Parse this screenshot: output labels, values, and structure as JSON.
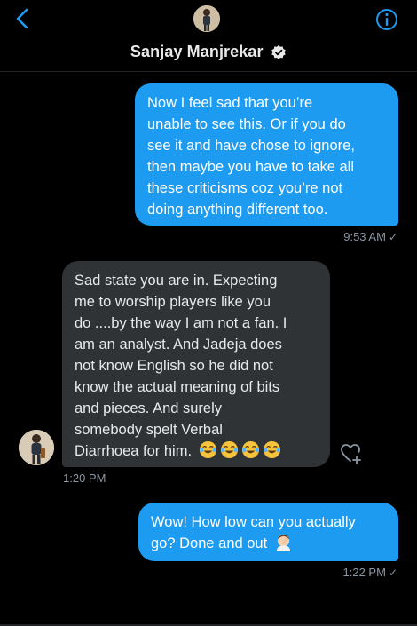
{
  "header": {
    "name": "Sanjay Manjrekar",
    "back_icon": "chevron-left-icon",
    "info_icon": "info-icon",
    "verified_icon": "verified-badge-icon",
    "accent": "#1d9bf0"
  },
  "messages": [
    {
      "direction": "outgoing",
      "lines": [
        "Now I feel sad that you’re",
        "unable to see this. Or if you do",
        "see it and have chose to ignore,",
        "then maybe you have to take all",
        "these criticisms coz you’re not",
        "doing anything different too."
      ],
      "time": "9:53 AM",
      "status": "✓"
    },
    {
      "direction": "incoming",
      "lines": [
        "Sad state you are in. Expecting",
        "me to worship players like you",
        "do ....by the way I am not a fan. I",
        "am an analyst. And Jadeja does",
        "not know English so he did not",
        "know the actual meaning of bits",
        "and pieces. And surely",
        "somebody spelt Verbal",
        "Diarrhoea for him."
      ],
      "emoji": "tears-of-joy-emoji x4",
      "time": "1:20 PM"
    },
    {
      "direction": "outgoing",
      "lines": [
        "Wow! How low can you actually",
        "go? Done and out"
      ],
      "emoji": "person-facepalming-emoji",
      "time": "1:22 PM",
      "status": "✓"
    }
  ]
}
